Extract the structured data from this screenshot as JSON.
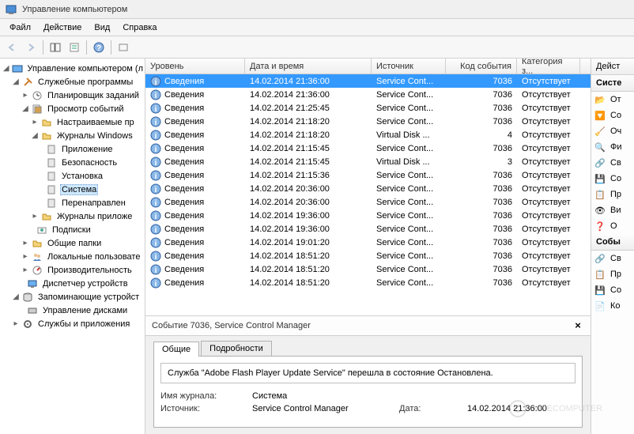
{
  "title": "Управление компьютером",
  "menu": {
    "file": "Файл",
    "action": "Действие",
    "view": "Вид",
    "help": "Справка"
  },
  "tree": {
    "root": "Управление компьютером (л",
    "sys_tools": "Служебные программы",
    "scheduler": "Планировщик заданий",
    "event_viewer": "Просмотр событий",
    "custom_views": "Настраиваемые пр",
    "win_logs": "Журналы Windows",
    "app_log": "Приложение",
    "security_log": "Безопасность",
    "setup_log": "Установка",
    "system_log": "Система",
    "forwarded": "Перенаправлен",
    "app_service_logs": "Журналы приложе",
    "subscriptions": "Подписки",
    "shared_folders": "Общие папки",
    "users_groups": "Локальные пользовате",
    "performance": "Производительность",
    "device_mgr": "Диспетчер устройств",
    "storage": "Запоминающие устройст",
    "disk_mgmt": "Управление дисками",
    "services_apps": "Службы и приложения"
  },
  "grid": {
    "cols": {
      "level": "Уровень",
      "datetime": "Дата и время",
      "source": "Источник",
      "event_id": "Код события",
      "category": "Категория з..."
    },
    "rows": [
      {
        "level": "Сведения",
        "dt": "14.02.2014 21:36:00",
        "src": "Service Cont...",
        "id": "7036",
        "cat": "Отсутствует",
        "sel": true
      },
      {
        "level": "Сведения",
        "dt": "14.02.2014 21:36:00",
        "src": "Service Cont...",
        "id": "7036",
        "cat": "Отсутствует"
      },
      {
        "level": "Сведения",
        "dt": "14.02.2014 21:25:45",
        "src": "Service Cont...",
        "id": "7036",
        "cat": "Отсутствует"
      },
      {
        "level": "Сведения",
        "dt": "14.02.2014 21:18:20",
        "src": "Service Cont...",
        "id": "7036",
        "cat": "Отсутствует"
      },
      {
        "level": "Сведения",
        "dt": "14.02.2014 21:18:20",
        "src": "Virtual Disk ...",
        "id": "4",
        "cat": "Отсутствует"
      },
      {
        "level": "Сведения",
        "dt": "14.02.2014 21:15:45",
        "src": "Service Cont...",
        "id": "7036",
        "cat": "Отсутствует"
      },
      {
        "level": "Сведения",
        "dt": "14.02.2014 21:15:45",
        "src": "Virtual Disk ...",
        "id": "3",
        "cat": "Отсутствует"
      },
      {
        "level": "Сведения",
        "dt": "14.02.2014 21:15:36",
        "src": "Service Cont...",
        "id": "7036",
        "cat": "Отсутствует"
      },
      {
        "level": "Сведения",
        "dt": "14.02.2014 20:36:00",
        "src": "Service Cont...",
        "id": "7036",
        "cat": "Отсутствует"
      },
      {
        "level": "Сведения",
        "dt": "14.02.2014 20:36:00",
        "src": "Service Cont...",
        "id": "7036",
        "cat": "Отсутствует"
      },
      {
        "level": "Сведения",
        "dt": "14.02.2014 19:36:00",
        "src": "Service Cont...",
        "id": "7036",
        "cat": "Отсутствует"
      },
      {
        "level": "Сведения",
        "dt": "14.02.2014 19:36:00",
        "src": "Service Cont...",
        "id": "7036",
        "cat": "Отсутствует"
      },
      {
        "level": "Сведения",
        "dt": "14.02.2014 19:01:20",
        "src": "Service Cont...",
        "id": "7036",
        "cat": "Отсутствует"
      },
      {
        "level": "Сведения",
        "dt": "14.02.2014 18:51:20",
        "src": "Service Cont...",
        "id": "7036",
        "cat": "Отсутствует"
      },
      {
        "level": "Сведения",
        "dt": "14.02.2014 18:51:20",
        "src": "Service Cont...",
        "id": "7036",
        "cat": "Отсутствует"
      },
      {
        "level": "Сведения",
        "dt": "14.02.2014 18:51:20",
        "src": "Service Cont...",
        "id": "7036",
        "cat": "Отсутствует"
      }
    ]
  },
  "detail": {
    "title": "Событие 7036, Service Control Manager",
    "tab_general": "Общие",
    "tab_details": "Подробности",
    "message": "Служба \"Adobe Flash Player Update Service\" перешла в состояние Остановлена.",
    "props": {
      "logname_k": "Имя журнала:",
      "logname_v": "Система",
      "source_k": "Источник:",
      "source_v": "Service Control Manager",
      "date_k": "Дата:",
      "date_v": "14.02.2014 21:36:00"
    }
  },
  "actions": {
    "head1": "Дейст",
    "head2": "Систе",
    "items1": [
      "От",
      "Со",
      "Оч",
      "Фи",
      "Св",
      "Со",
      "Пр",
      "Ви",
      "О"
    ],
    "items2": [
      "Св",
      "Пр",
      "Со",
      "Ко"
    ],
    "head3": "Собы"
  },
  "watermark": "NICECOMPUTER"
}
